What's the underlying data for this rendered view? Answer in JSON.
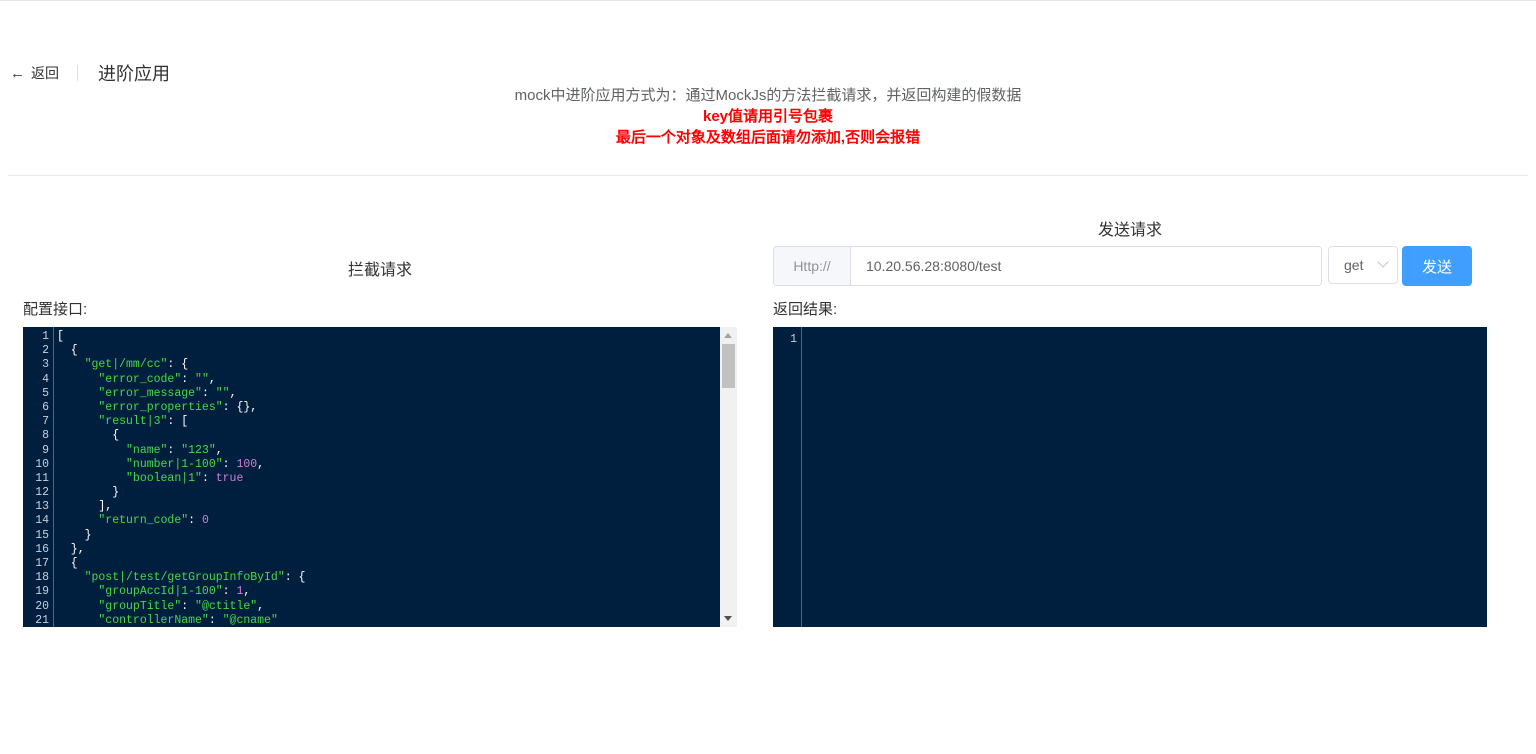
{
  "header": {
    "back_label": "返回",
    "title": "进阶应用"
  },
  "notes": {
    "description": "mock中进阶应用方式为：通过MockJs的方法拦截请求，并返回构建的假数据",
    "warning_1": "key值请用引号包裹",
    "warning_2": "最后一个对象及数组后面请勿添加,否则会报错"
  },
  "left": {
    "title": "拦截请求",
    "label": "配置接口:",
    "code_lines": [
      [
        [
          "p",
          "["
        ]
      ],
      [
        [
          "p",
          "  {"
        ]
      ],
      [
        [
          "s",
          "    \"get|/mm/cc\""
        ],
        [
          "p",
          ": {"
        ]
      ],
      [
        [
          "s",
          "      \"error_code\""
        ],
        [
          "p",
          ": "
        ],
        [
          "s",
          "\"\""
        ],
        [
          "p",
          ","
        ]
      ],
      [
        [
          "s",
          "      \"error_message\""
        ],
        [
          "p",
          ": "
        ],
        [
          "s",
          "\"\""
        ],
        [
          "p",
          ","
        ]
      ],
      [
        [
          "s",
          "      \"error_properties\""
        ],
        [
          "p",
          ": {},"
        ]
      ],
      [
        [
          "s",
          "      \"result|3\""
        ],
        [
          "p",
          ": ["
        ]
      ],
      [
        [
          "p",
          "        {"
        ]
      ],
      [
        [
          "s",
          "          \"name\""
        ],
        [
          "p",
          ": "
        ],
        [
          "s",
          "\"123\""
        ],
        [
          "p",
          ","
        ]
      ],
      [
        [
          "s",
          "          \"number|1-100\""
        ],
        [
          "p",
          ": "
        ],
        [
          "n",
          "100"
        ],
        [
          "p",
          ","
        ]
      ],
      [
        [
          "s",
          "          \"boolean|1\""
        ],
        [
          "p",
          ": "
        ],
        [
          "n",
          "true"
        ]
      ],
      [
        [
          "p",
          "        }"
        ]
      ],
      [
        [
          "p",
          "      ],"
        ]
      ],
      [
        [
          "s",
          "      \"return_code\""
        ],
        [
          "p",
          ": "
        ],
        [
          "n",
          "0"
        ]
      ],
      [
        [
          "p",
          "    }"
        ]
      ],
      [
        [
          "p",
          "  },"
        ]
      ],
      [
        [
          "p",
          "  {"
        ]
      ],
      [
        [
          "s",
          "    \"post|/test/getGroupInfoById\""
        ],
        [
          "p",
          ": {"
        ]
      ],
      [
        [
          "s",
          "      \"groupAccId|1-100\""
        ],
        [
          "p",
          ": "
        ],
        [
          "n",
          "1"
        ],
        [
          "p",
          ","
        ]
      ],
      [
        [
          "s",
          "      \"groupTitle\""
        ],
        [
          "p",
          ": "
        ],
        [
          "s",
          "\"@ctitle\""
        ],
        [
          "p",
          ","
        ]
      ],
      [
        [
          "s",
          "      \"controllerName\""
        ],
        [
          "p",
          ": "
        ],
        [
          "s",
          "\"@cname\""
        ]
      ]
    ]
  },
  "right": {
    "title": "发送请求",
    "prefix": "Http://",
    "url_value": "10.20.56.28:8080/test",
    "method": "get",
    "send_label": "发送",
    "label": "返回结果:",
    "code_lines": [
      [
        [
          "p",
          ""
        ]
      ]
    ]
  },
  "colors": {
    "editor_bg": "#001f3f",
    "string": "#45d946",
    "number": "#d17fd3",
    "primary": "#409eff",
    "warning": "#ff0000"
  }
}
